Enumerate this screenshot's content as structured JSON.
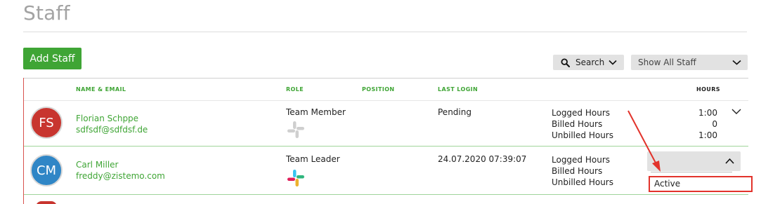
{
  "page": {
    "title": "Staff"
  },
  "toolbar": {
    "add_staff_label": "Add Staff",
    "search_label": "Search",
    "filter_value": "Show All Staff"
  },
  "table": {
    "columns": {
      "name_email": "NAME & EMAIL",
      "role": "ROLE",
      "position": "POSITION",
      "last_login": "LAST LOGIN",
      "hours": "HOURS"
    },
    "rows": [
      {
        "initials": "FS",
        "avatar_color": "#c8352f",
        "name": "Florian Schppe",
        "email": "sdfsdf@sdfdsf.de",
        "role": "Team Member",
        "slack_icon": "slack-icon-gray",
        "last_login": "Pending",
        "hour_labels": [
          "Logged Hours",
          "Billed Hours",
          "Unbilled Hours"
        ],
        "hour_values": [
          "1:00",
          "0",
          "1:00"
        ]
      },
      {
        "initials": "CM",
        "avatar_color": "#2f86c6",
        "name": "Carl Miller",
        "email": "freddy@zistemo.com",
        "role": "Team Leader",
        "slack_icon": "slack-icon-color",
        "last_login": "24.07.2020 07:39:07",
        "hour_labels": [
          "Logged Hours",
          "Billed Hours",
          "Unbilled Hours"
        ],
        "status_dropdown": {
          "selected": "",
          "options": [
            "Active"
          ]
        }
      }
    ]
  },
  "colors": {
    "accent_green": "#3fa535",
    "highlight_red": "#e2332b",
    "control_gray": "#e2e2e2"
  }
}
